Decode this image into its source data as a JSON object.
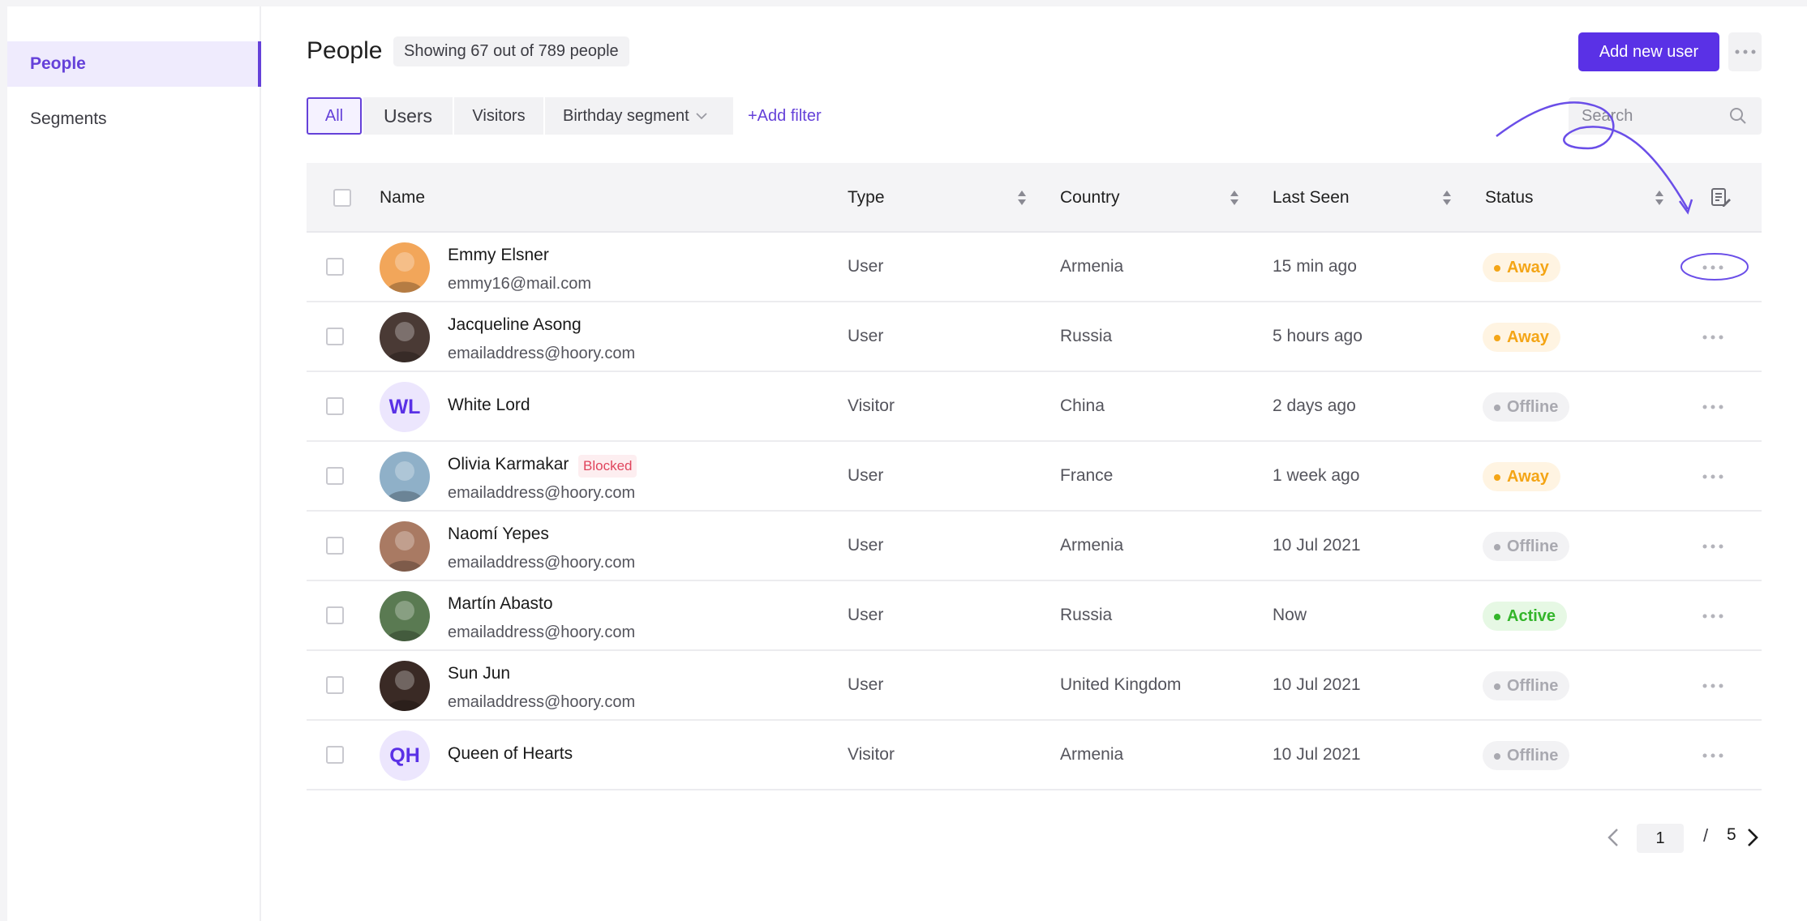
{
  "sidebar": {
    "items": [
      {
        "label": "People",
        "active": true
      },
      {
        "label": "Segments",
        "active": false
      }
    ]
  },
  "header": {
    "title": "People",
    "count_text": "Showing 67 out of 789 people",
    "add_button": "Add new user",
    "more_icon": "ellipsis-icon"
  },
  "filters": {
    "tabs": [
      "All",
      "Users",
      "Visitors",
      "Birthday segment"
    ],
    "active_tab": "All",
    "add_filter": "+Add filter"
  },
  "search": {
    "placeholder": "Search"
  },
  "table": {
    "columns": {
      "name": "Name",
      "type": "Type",
      "country": "Country",
      "last_seen": "Last Seen",
      "status": "Status"
    },
    "rows": [
      {
        "name": "Emmy Elsner",
        "email": "emmy16@mail.com",
        "type": "User",
        "country": "Armenia",
        "last_seen": "15 min ago",
        "status": "Away",
        "status_kind": "away",
        "avatar": "photo",
        "initials": "",
        "blocked": ""
      },
      {
        "name": "Jacqueline Asong",
        "email": "emailaddress@hoory.com",
        "type": "User",
        "country": "Russia",
        "last_seen": "5 hours ago",
        "status": "Away",
        "status_kind": "away",
        "avatar": "photo",
        "initials": "",
        "blocked": ""
      },
      {
        "name": "White Lord",
        "email": "",
        "type": "Visitor",
        "country": "China",
        "last_seen": "2 days ago",
        "status": "Offline",
        "status_kind": "offline",
        "avatar": "initials",
        "initials": "WL",
        "blocked": ""
      },
      {
        "name": "Olivia Karmakar",
        "email": "emailaddress@hoory.com",
        "type": "User",
        "country": "France",
        "last_seen": "1 week ago",
        "status": "Away",
        "status_kind": "away",
        "avatar": "photo",
        "initials": "",
        "blocked": "Blocked"
      },
      {
        "name": "Naomí Yepes",
        "email": "emailaddress@hoory.com",
        "type": "User",
        "country": "Armenia",
        "last_seen": "10 Jul 2021",
        "status": "Offline",
        "status_kind": "offline",
        "avatar": "photo",
        "initials": "",
        "blocked": ""
      },
      {
        "name": "Martín Abasto",
        "email": "emailaddress@hoory.com",
        "type": "User",
        "country": "Russia",
        "last_seen": "Now",
        "status": "Active",
        "status_kind": "active",
        "avatar": "photo",
        "initials": "",
        "blocked": ""
      },
      {
        "name": "Sun Jun",
        "email": "emailaddress@hoory.com",
        "type": "User",
        "country": "United Kingdom",
        "last_seen": "10 Jul 2021",
        "status": "Offline",
        "status_kind": "offline",
        "avatar": "photo",
        "initials": "",
        "blocked": ""
      },
      {
        "name": "Queen of Hearts",
        "email": "",
        "type": "Visitor",
        "country": "Armenia",
        "last_seen": "10 Jul 2021",
        "status": "Offline",
        "status_kind": "offline",
        "avatar": "initials",
        "initials": "QH",
        "blocked": ""
      }
    ]
  },
  "pagination": {
    "current_page": "1",
    "separator": "/",
    "total_pages": "5"
  },
  "colors": {
    "accent": "#5a31e6",
    "away": "#f4a516",
    "offline": "#a9a9b0",
    "active": "#33b52a",
    "blocked": "#e0455d"
  }
}
